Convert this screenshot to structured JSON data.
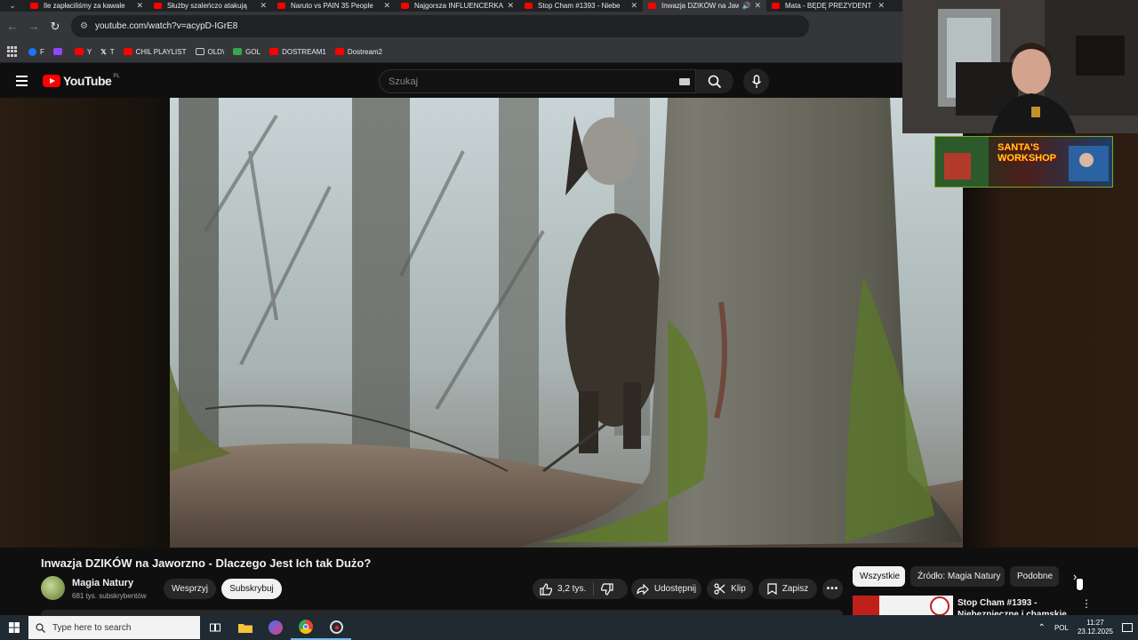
{
  "browser": {
    "tabs": [
      {
        "title": "Ile zapłaciliśmy za kawale",
        "active": false
      },
      {
        "title": "Służby szaleńczo atakują",
        "active": false
      },
      {
        "title": "Naruto vs PAIN 35 People",
        "active": false
      },
      {
        "title": "Najgorsza INFLUENCERKA",
        "active": false
      },
      {
        "title": "Stop Cham #1393 - Niebe",
        "active": false
      },
      {
        "title": "Inwazja DZIKÓW na Jawo",
        "active": true
      },
      {
        "title": "Mata - BĘDĘ PREZYDENT",
        "active": false
      }
    ],
    "url": "youtube.com/watch?v=acypD-IGrE8",
    "bookmarks": [
      {
        "label": "F",
        "color": "#1877f2"
      },
      {
        "label": "",
        "color": "#9146ff"
      },
      {
        "label": "Y",
        "color": "#ff0000"
      },
      {
        "label": "T",
        "color": "#ffffff"
      },
      {
        "label": "CHIL PLAYLIST",
        "color": "#ff0000"
      },
      {
        "label": "OLD\\",
        "color": "folder"
      },
      {
        "label": "GOL",
        "color": "#34a853"
      },
      {
        "label": "DOSTREAM1",
        "color": "#ff0000"
      },
      {
        "label": "Dostream2",
        "color": "#ff0000"
      }
    ]
  },
  "youtube": {
    "logo_text": "YouTube",
    "country_code": "PL",
    "search_placeholder": "Szukaj"
  },
  "overlay": {
    "banner_text_1": "SANTA'S",
    "banner_text_2": "WORKSHOP"
  },
  "video": {
    "title": "Inwazja DZIKÓW na Jaworzno - Dlaczego Jest Ich tak Dużo?",
    "channel_name": "Magia Natury",
    "subscribers": "681 tys. subskrybentów",
    "support_label": "Wesprzyj",
    "subscribe_label": "Subskrybuj",
    "likes": "3,2 tys.",
    "share_label": "Udostępnij",
    "clip_label": "Klip",
    "save_label": "Zapisz"
  },
  "sidebar": {
    "chips": [
      "Wszystkie",
      "Źródło: Magia Natury",
      "Podobne"
    ],
    "recommendation_title": "Stop Cham #1393 - Niebezpieczne i chamskie"
  },
  "taskbar": {
    "search_placeholder": "Type here to search",
    "language": "POL",
    "time": "11:27",
    "date": "23.12.2025"
  }
}
